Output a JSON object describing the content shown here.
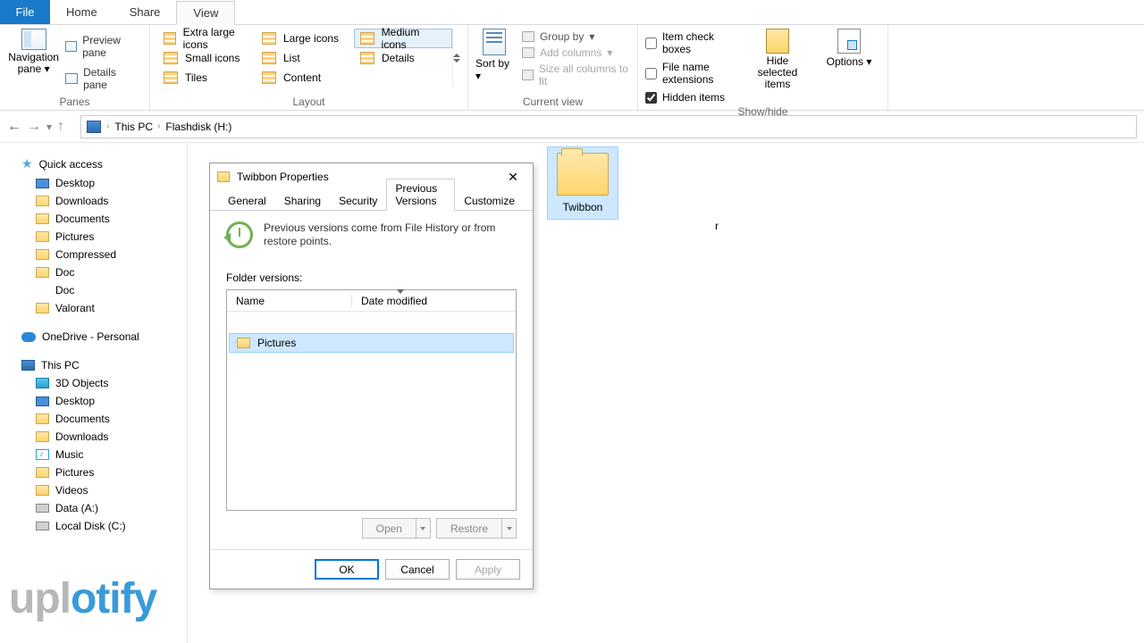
{
  "tabs": {
    "file": "File",
    "home": "Home",
    "share": "Share",
    "view": "View",
    "active": "View"
  },
  "ribbon": {
    "panes": {
      "label": "Panes",
      "navigation_pane": "Navigation pane",
      "preview_pane": "Preview pane",
      "details_pane": "Details pane"
    },
    "layout": {
      "label": "Layout",
      "extra_large": "Extra large icons",
      "large": "Large icons",
      "medium": "Medium icons",
      "small": "Small icons",
      "list": "List",
      "details": "Details",
      "tiles": "Tiles",
      "content": "Content",
      "selected": "Medium icons"
    },
    "current_view": {
      "label": "Current view",
      "sort_by": "Sort by",
      "group_by": "Group by",
      "add_columns": "Add columns",
      "size_all": "Size all columns to fit"
    },
    "show_hide": {
      "label": "Show/hide",
      "item_checkboxes": "Item check boxes",
      "file_ext": "File name extensions",
      "hidden_items": "Hidden items",
      "hidden_checked": true,
      "hide_selected": "Hide selected items",
      "options": "Options"
    }
  },
  "breadcrumb": {
    "this_pc": "This PC",
    "drive": "Flashdisk (H:)"
  },
  "sidebar": {
    "quick_access": "Quick access",
    "desktop": "Desktop",
    "downloads": "Downloads",
    "documents": "Documents",
    "pictures": "Pictures",
    "compressed": "Compressed",
    "doc": "Doc",
    "doc2": "Doc",
    "valorant": "Valorant",
    "onedrive": "OneDrive - Personal",
    "this_pc": "This PC",
    "objects_3d": "3D Objects",
    "desktop2": "Desktop",
    "documents2": "Documents",
    "downloads2": "Downloads",
    "music": "Music",
    "pictures2": "Pictures",
    "videos": "Videos",
    "data_a": "Data (A:)",
    "local_c": "Local Disk (C:)"
  },
  "content": {
    "folder_partial_label": "r",
    "folder2": "Twibbon"
  },
  "dialog": {
    "title": "Twibbon Properties",
    "tabs": {
      "general": "General",
      "sharing": "Sharing",
      "security": "Security",
      "previous": "Previous Versions",
      "customize": "Customize"
    },
    "info": "Previous versions come from File History or from restore points.",
    "versions_label": "Folder versions:",
    "col_name": "Name",
    "col_date": "Date modified",
    "row1": "Pictures",
    "open": "Open",
    "restore": "Restore",
    "ok": "OK",
    "cancel": "Cancel",
    "apply": "Apply"
  },
  "watermark": {
    "a": "upl",
    "b": "otify"
  }
}
